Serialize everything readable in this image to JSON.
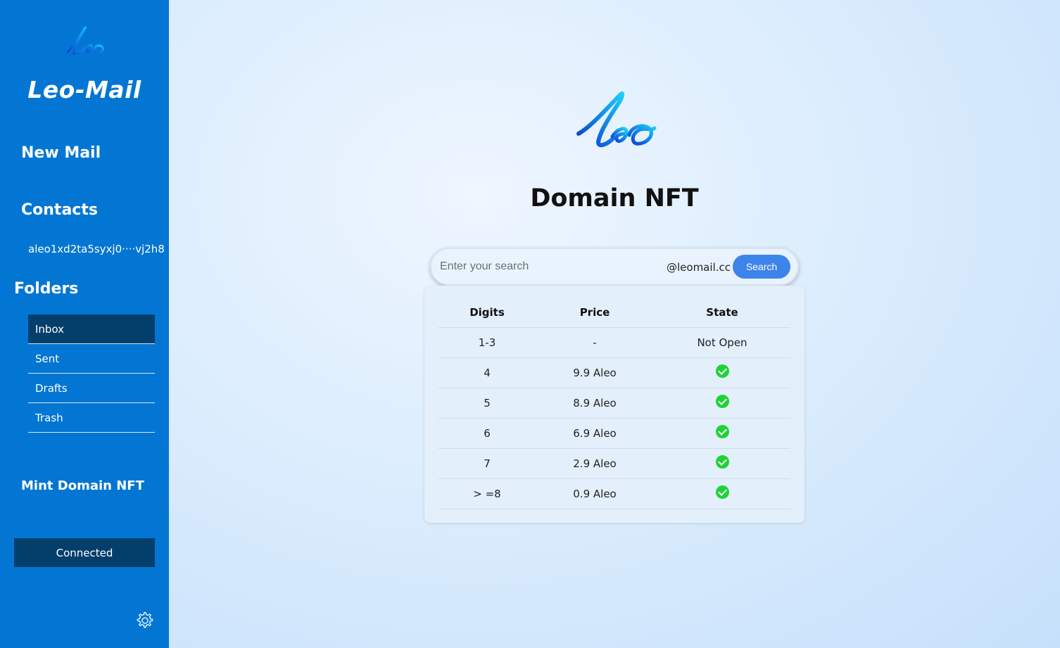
{
  "sidebar": {
    "logo_text": "leo",
    "app_title": "Leo-Mail",
    "new_mail": "New Mail",
    "contacts": "Contacts",
    "contact_address": "aleo1xd2ta5syxj0····vj2h8",
    "folders_heading": "Folders",
    "folders": [
      {
        "label": "Inbox",
        "active": true
      },
      {
        "label": "Sent",
        "active": false
      },
      {
        "label": "Drafts",
        "active": false
      },
      {
        "label": "Trash",
        "active": false
      }
    ],
    "mint_domain": "Mint Domain NFT",
    "connected_button": "Connected",
    "settings_icon": "gear-icon"
  },
  "main": {
    "logo_text": "leo",
    "title": "Domain NFT",
    "search": {
      "placeholder": "Enter your search",
      "value": "",
      "suffix": "@leomail.cc",
      "button": "Search"
    },
    "table": {
      "headers": [
        "Digits",
        "Price",
        "State"
      ],
      "rows": [
        {
          "digits": "1-3",
          "price": "-",
          "state": "Not Open",
          "available": false
        },
        {
          "digits": "4",
          "price": "9.9 Aleo",
          "state": "",
          "available": true
        },
        {
          "digits": "5",
          "price": "8.9 Aleo",
          "state": "",
          "available": true
        },
        {
          "digits": "6",
          "price": "6.9 Aleo",
          "state": "",
          "available": true
        },
        {
          "digits": "7",
          "price": "2.9 Aleo",
          "state": "",
          "available": true
        },
        {
          "digits": "> =8",
          "price": "0.9 Aleo",
          "state": "",
          "available": true
        }
      ]
    }
  },
  "colors": {
    "sidebar_bg": "#0376d4",
    "active_folder_bg": "#043f6c",
    "search_button": "#3d84ea",
    "check_green": "#1ed336"
  }
}
